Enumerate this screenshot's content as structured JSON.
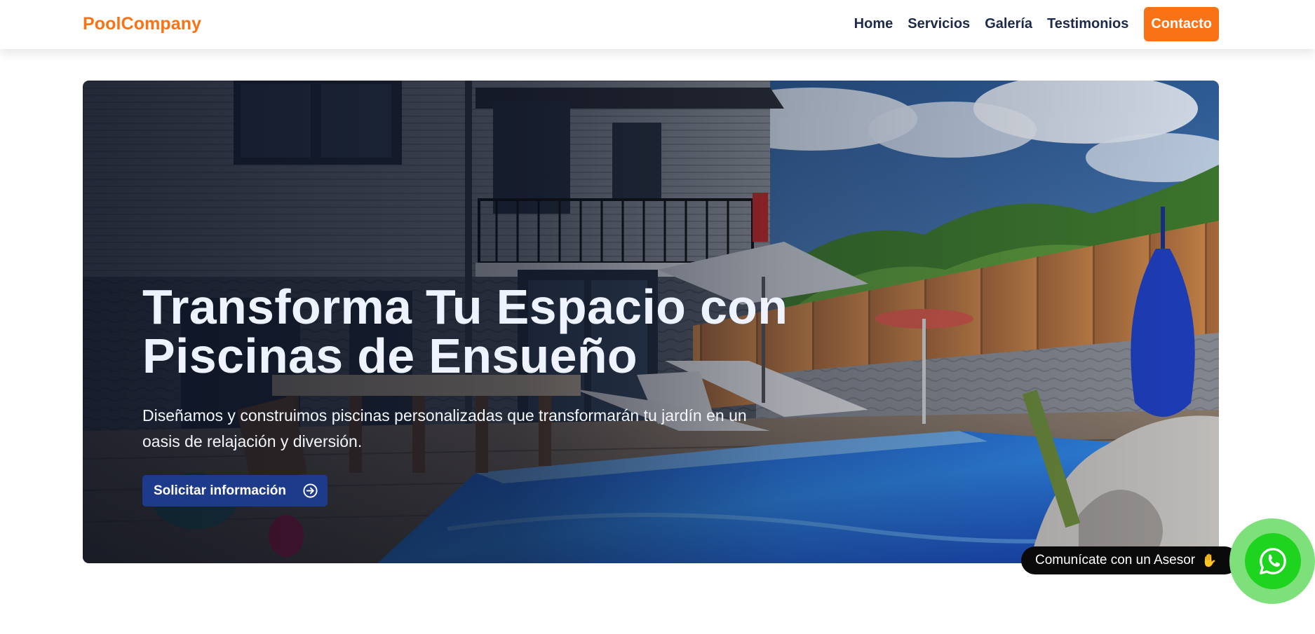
{
  "header": {
    "logo": "PoolCompany",
    "nav": [
      {
        "label": "Home"
      },
      {
        "label": "Servicios"
      },
      {
        "label": "Galería"
      },
      {
        "label": "Testimonios"
      }
    ],
    "cta_label": "Contacto"
  },
  "hero": {
    "title_line1": "Transforma Tu Espacio con",
    "title_line2": "Piscinas de Ensueño",
    "subtitle_line1": "Diseñamos y construimos piscinas personalizadas que transformarán tu jardín en un",
    "subtitle_line2": "oasis de relajación y diversión.",
    "button_label": "Solicitar información",
    "button_icon": "arrow-right-circle-icon",
    "image_icon": "pool-house-photo"
  },
  "whatsapp": {
    "tooltip": "Comunícate con un Asesor",
    "tooltip_emoji": "✋",
    "icon": "whatsapp-icon"
  },
  "colors": {
    "brand_orange": "#f97316",
    "nav_text": "#1e2a4a",
    "hero_button": "#1e3a8a",
    "whatsapp_green": "#1ed41e",
    "whatsapp_ring": "#7ee07a"
  }
}
